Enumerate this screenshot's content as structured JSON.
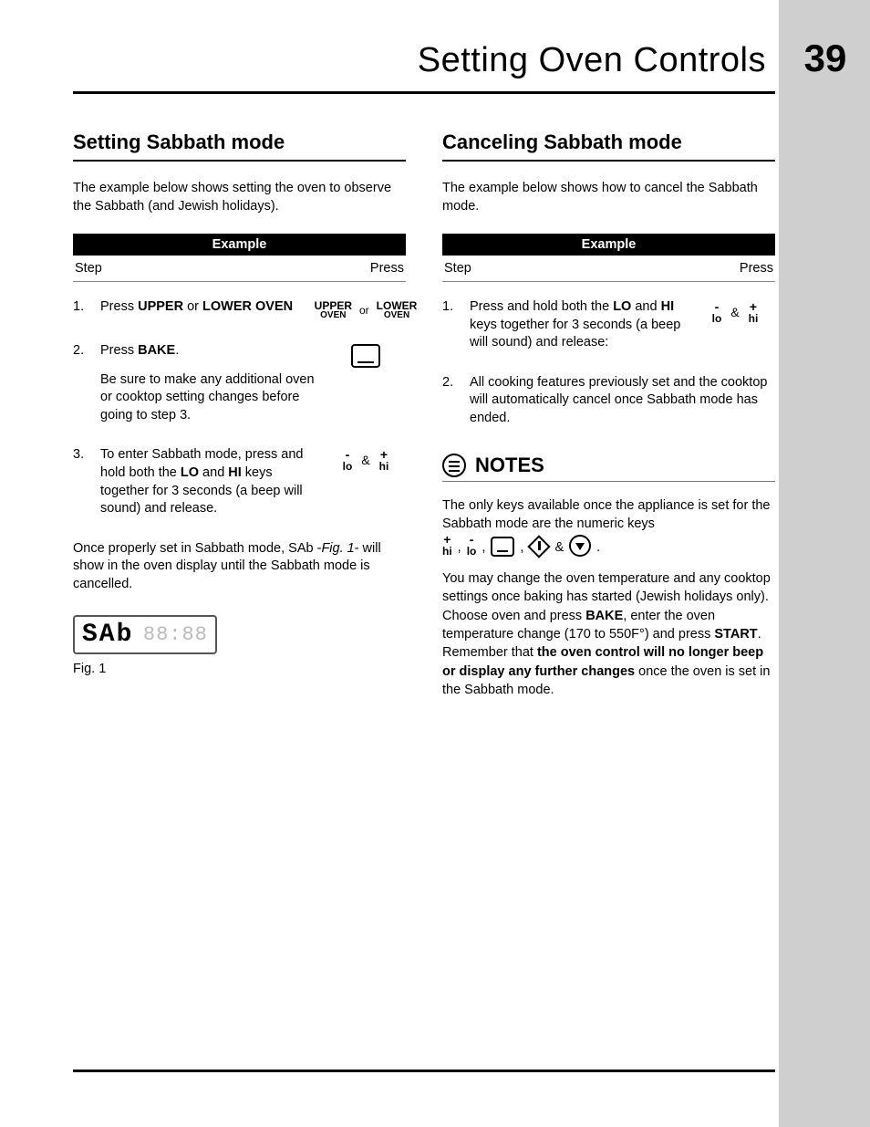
{
  "header": {
    "title": "Setting Oven Controls",
    "page_number": "39"
  },
  "left": {
    "heading": "Setting Sabbath mode",
    "intro": "The example below shows setting the oven to observe the Sabbath (and Jewish holidays).",
    "table": {
      "title": "Example",
      "col_step": "Step",
      "col_press": "Press"
    },
    "steps": {
      "s1_pre": "Press ",
      "s1_b1": "UPPER",
      "s1_mid": " or ",
      "s1_b2": "LOWER OVEN",
      "s1_key_upper_top": "UPPER",
      "s1_key_upper_bot": "OVEN",
      "s1_key_or": "or",
      "s1_key_lower_top": "LOWER",
      "s1_key_lower_bot": "OVEN",
      "s2_pre": "Press ",
      "s2_b": "BAKE",
      "s2_post": ".",
      "s2_sub": "Be sure to make any additional oven or cooktop setting changes before going to step 3.",
      "s3_pre": "To enter Sabbath mode, press and hold both the ",
      "s3_b1": "LO",
      "s3_mid": " and ",
      "s3_b2": "HI",
      "s3_post": " keys together for 3 seconds (a beep will sound) and release.",
      "lo_label": "lo",
      "hi_label": "hi",
      "amp": "&"
    },
    "after_pre": "Once properly set in Sabbath mode, SAb -",
    "after_fig": "Fig. 1",
    "after_post": "- will show in the oven display until the Sabbath mode is cancelled.",
    "display_main": "SAb",
    "display_dim": "88:88",
    "fig_caption": "Fig. 1"
  },
  "right": {
    "heading": "Canceling Sabbath mode",
    "intro": "The example below shows how to cancel the Sabbath mode.",
    "table": {
      "title": "Example",
      "col_step": "Step",
      "col_press": "Press"
    },
    "steps": {
      "s1_pre": "Press and hold both the ",
      "s1_b1": "LO",
      "s1_mid": " and ",
      "s1_b2": "HI",
      "s1_post": " keys together for 3 seconds (a beep will sound) and release:",
      "lo_label": "lo",
      "hi_label": "hi",
      "amp": "&",
      "s2": "All cooking features previously set and the cooktop will automatically cancel once Sabbath mode has ended."
    },
    "notes": {
      "title": "NOTES",
      "p1": "The only keys available once the appliance is set for the Sabbath mode are the numeric keys",
      "hi_label": "hi",
      "lo_label": "lo",
      "comma1": ",",
      "comma2": ",",
      "comma3": ",",
      "amp": "&",
      "period": ".",
      "p2_a": "You may change the oven temperature and any cooktop settings once baking has started (Jewish holidays only). Choose oven and press ",
      "p2_b1": "BAKE",
      "p2_b": ", enter the oven temperature change (170 to 550F°) and press ",
      "p2_b2": "START",
      "p2_c": ". Remember that ",
      "p2_b3": "the oven control will no longer beep or display any further changes",
      "p2_d": " once the oven is set in the Sabbath mode."
    }
  }
}
